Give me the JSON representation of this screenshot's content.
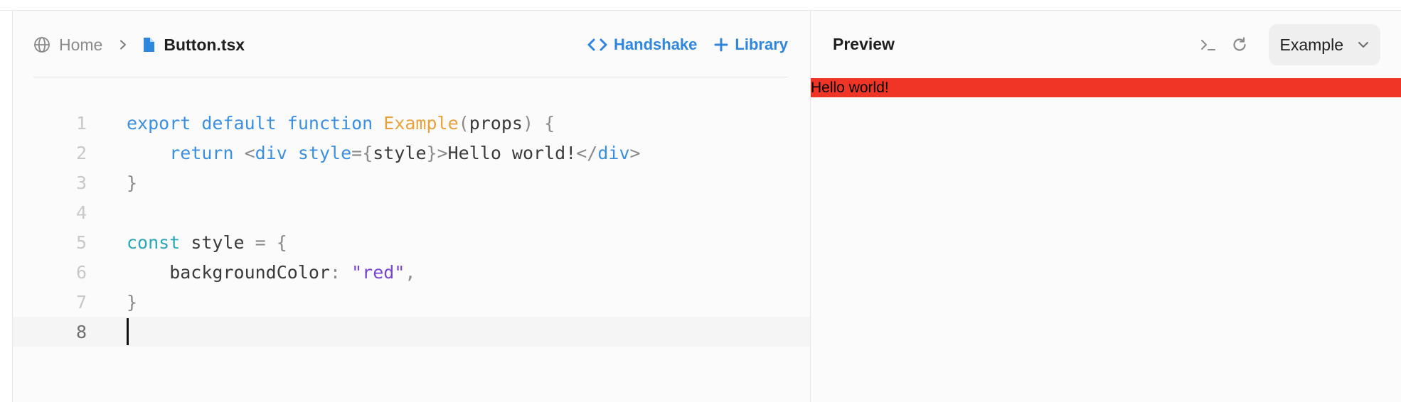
{
  "breadcrumb": {
    "home_label": "Home",
    "file_label": "Button.tsx",
    "home_icon": "globe-icon",
    "separator_icon": "chevron-right-icon",
    "file_icon": "file-icon"
  },
  "actions": {
    "handshake_label": "Handshake",
    "library_label": "Library",
    "handshake_icon": "code-brackets-icon",
    "library_icon": "plus-icon"
  },
  "editor": {
    "language": "tsx",
    "line_numbers": [
      "1",
      "2",
      "3",
      "4",
      "5",
      "6",
      "7",
      "8"
    ],
    "active_line": "8",
    "lines": [
      "export default function Example(props) {",
      "    return <div style={style}>Hello world!</div>",
      "}",
      "",
      "const style = {",
      "    backgroundColor: \"red\",",
      "}",
      ""
    ]
  },
  "preview": {
    "title": "Preview",
    "console_icon": "terminal-icon",
    "refresh_icon": "refresh-icon",
    "selected_example": "Example",
    "dropdown_icon": "chevron-down-icon",
    "output_text": "Hello world!",
    "output_background": "#ee3526"
  },
  "colors": {
    "accent": "#2f86dd",
    "keyword": "#3b8fe0",
    "keyword_const": "#2aa7b8",
    "function_name": "#e9a23b",
    "string": "#7a43d8"
  }
}
